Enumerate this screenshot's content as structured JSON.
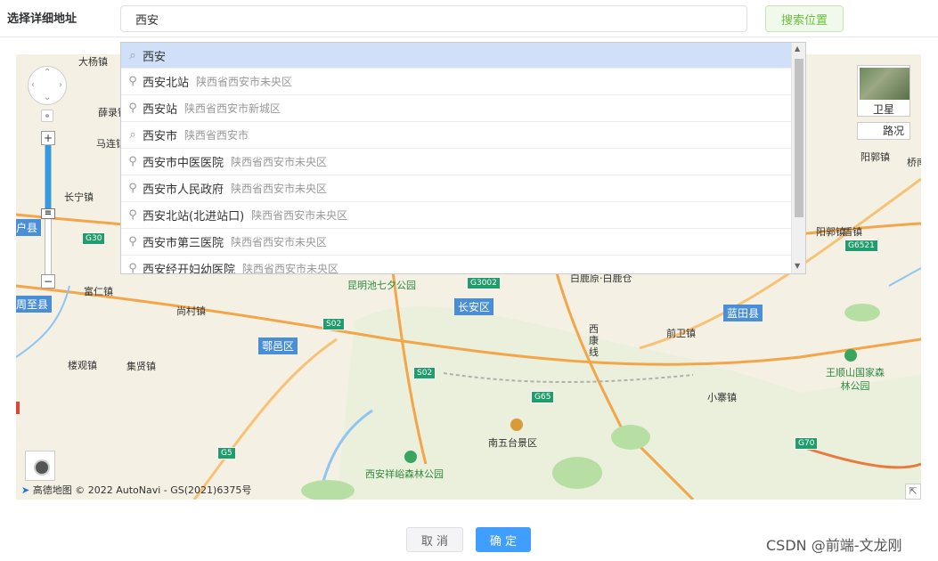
{
  "header": {
    "label": "选择详细地址",
    "search_value": "西安",
    "search_button": "搜索位置"
  },
  "dropdown": {
    "items": [
      {
        "icon": "search-icon",
        "name": "西安",
        "addr": ""
      },
      {
        "icon": "pin-icon",
        "name": "西安北站",
        "addr": "陕西省西安市未央区"
      },
      {
        "icon": "pin-icon",
        "name": "西安站",
        "addr": "陕西省西安市新城区"
      },
      {
        "icon": "search-icon",
        "name": "西安市",
        "addr": "陕西省西安市"
      },
      {
        "icon": "pin-icon",
        "name": "西安市中医医院",
        "addr": "陕西省西安市未央区"
      },
      {
        "icon": "pin-icon",
        "name": "西安市人民政府",
        "addr": "陕西省西安市未央区"
      },
      {
        "icon": "pin-icon",
        "name": "西安北站(北进站口)",
        "addr": "陕西省西安市未央区"
      },
      {
        "icon": "pin-icon",
        "name": "西安市第三医院",
        "addr": "陕西省西安市未央区"
      },
      {
        "icon": "pin-icon",
        "name": "西安经开妇幼医院",
        "addr": "陕西省西安市未央区"
      }
    ]
  },
  "map": {
    "layer_satellite": "卫星",
    "layer_traffic": "路况",
    "zoom_in": "+",
    "zoom_out": "−",
    "copyright_logo": "高德地图",
    "copyright_text": "© 2022 AutoNavi - GS(2021)6375号",
    "places": [
      "大杨镇",
      "薛录镇",
      "马连镇",
      "长宁镇",
      "富仁镇",
      "尚村镇",
      "楼观镇",
      "集贤镇",
      "甘亭镇",
      "前卫镇",
      "小寨镇",
      "阳郭镇",
      "唐镇",
      "盾镇",
      "白鹿原·白鹿仓",
      "西康线",
      "桥南"
    ],
    "counties": [
      "户县",
      "周至县",
      "鄠邑区",
      "长安区",
      "蓝田县"
    ],
    "roads": [
      "G30",
      "G3002",
      "S02",
      "S02",
      "G65",
      "G5",
      "G70",
      "G6521"
    ],
    "pois": [
      "昆明池七夕公园",
      "南五台景区",
      "西安祥峪森林公园",
      "王顺山国家森林公园"
    ]
  },
  "footer": {
    "cancel": "取 消",
    "confirm": "确 定"
  },
  "watermark": "CSDN @前端-文龙刚",
  "colors": {
    "primary": "#409eff",
    "success": "#67c23a",
    "highlight": "#cfe0f8"
  }
}
